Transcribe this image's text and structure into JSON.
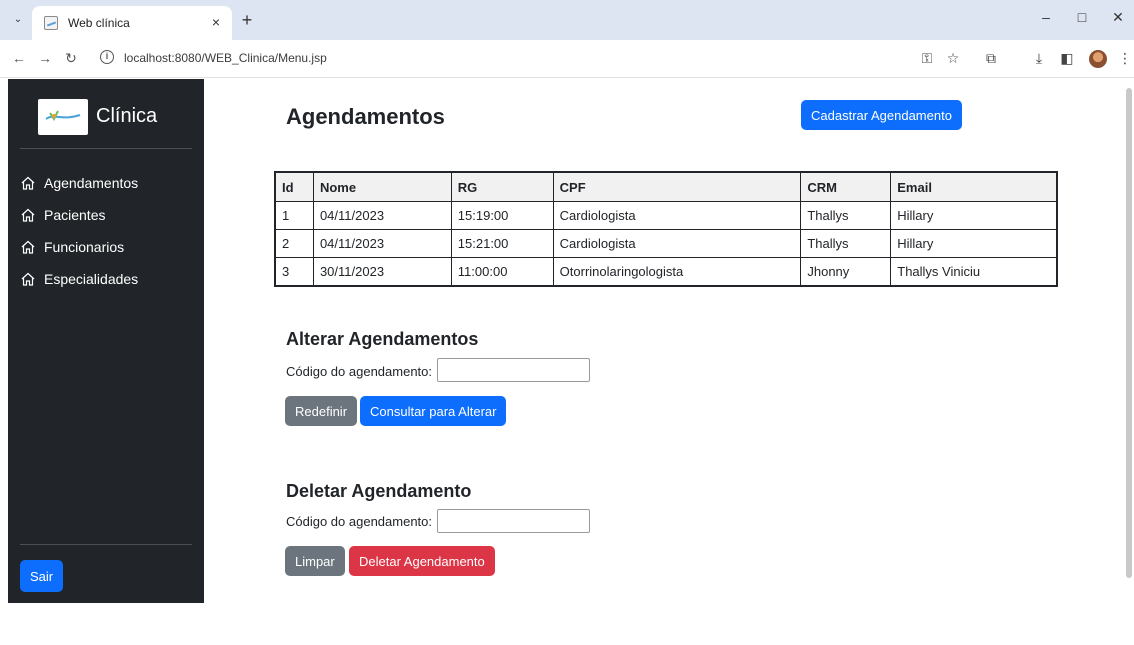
{
  "browser": {
    "tab_title": "Web clínica",
    "tab_close": "×",
    "new_tab": "+",
    "url": "localhost:8080/WEB_Clinica/Menu.jsp"
  },
  "sidebar": {
    "brand": "Clínica",
    "items": [
      {
        "label": "Agendamentos"
      },
      {
        "label": "Pacientes"
      },
      {
        "label": "Funcionarios"
      },
      {
        "label": "Especialidades"
      }
    ],
    "logout_label": "Sair"
  },
  "main": {
    "title": "Agendamentos",
    "add_button": "Cadastrar Agendamento",
    "table": {
      "headers": [
        "Id",
        "Nome",
        "RG",
        "CPF",
        "CRM",
        "Email"
      ],
      "rows": [
        [
          "1",
          "04/11/2023",
          "15:19:00",
          "Cardiologista",
          "Thallys",
          "Hillary"
        ],
        [
          "2",
          "04/11/2023",
          "15:21:00",
          "Cardiologista",
          "Thallys",
          "Hillary"
        ],
        [
          "3",
          "30/11/2023",
          "11:00:00",
          "Otorrinolaringologista",
          "Jhonny",
          "Thallys Viniciu"
        ]
      ]
    },
    "alter": {
      "title": "Alterar Agendamentos",
      "label": "Código do agendamento:",
      "value": "",
      "reset_button": "Redefinir",
      "submit_button": "Consultar para Alterar"
    },
    "delete": {
      "title": "Deletar Agendamento",
      "label": "Código do agendamento:",
      "value": "",
      "reset_button": "Limpar",
      "submit_button": "Deletar Agendamento"
    }
  },
  "colors": {
    "sidebar_bg": "#212529",
    "primary": "#0d6efd",
    "secondary": "#6c757d",
    "danger": "#dc3545"
  }
}
